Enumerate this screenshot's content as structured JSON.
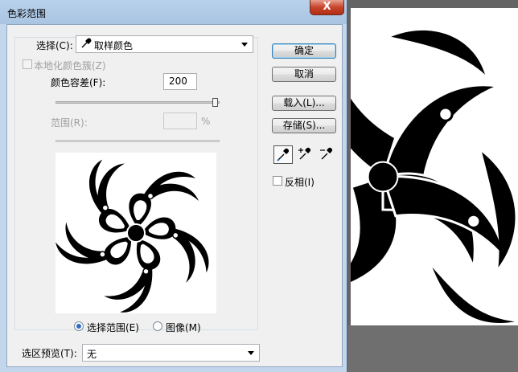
{
  "dialog": {
    "title": "色彩范围",
    "close_glyph": "X"
  },
  "select": {
    "label": "选择(C):",
    "value": "取样颜色",
    "icon": "eyedropper-icon"
  },
  "localized_clusters": {
    "label": "本地化颜色簇(Z)",
    "checked": false,
    "enabled": false
  },
  "fuzziness": {
    "label": "颜色容差(F):",
    "value": "200",
    "slider_fraction": 1.0
  },
  "range": {
    "label": "范围(R):",
    "value": "",
    "unit": "%",
    "enabled": false
  },
  "preview_mode": {
    "options": [
      {
        "label": "选择范围(E)",
        "selected": true
      },
      {
        "label": "图像(M)",
        "selected": false
      }
    ]
  },
  "selection_preview": {
    "label": "选区预览(T):",
    "value": "无"
  },
  "buttons": {
    "ok": "确定",
    "cancel": "取消",
    "load": "载入(L)...",
    "save": "存储(S)..."
  },
  "tools": [
    "eyedropper-icon",
    "eyedropper-plus-icon",
    "eyedropper-minus-icon"
  ],
  "invert": {
    "label": "反相(I)",
    "checked": false
  },
  "colors": {
    "title_bar": "#b9d1ea",
    "close_button": "#c7452c",
    "canvas_background": "#646464"
  }
}
